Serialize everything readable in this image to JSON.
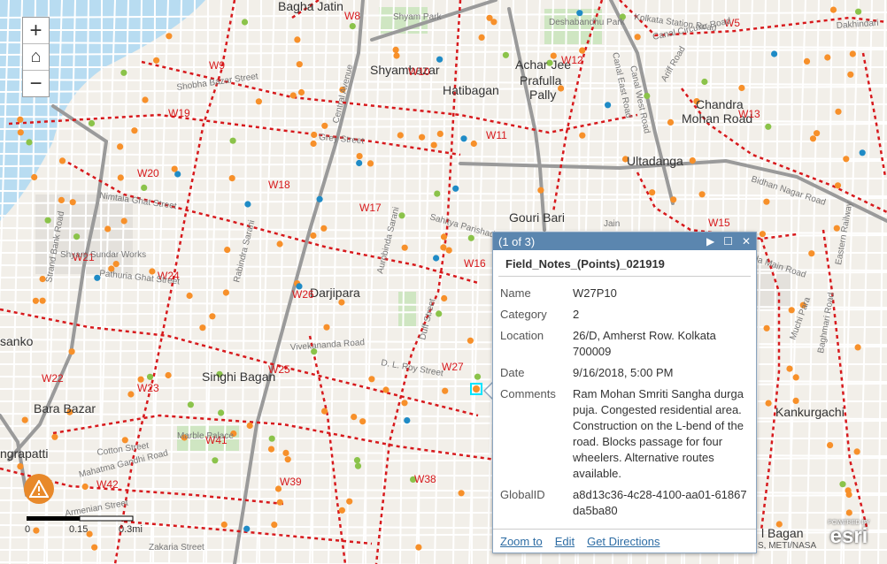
{
  "map": {
    "places": [
      {
        "name": "Bagha Jatin"
      },
      {
        "name": "Shyambazar"
      },
      {
        "name": "Achar Jee"
      },
      {
        "name": "Prafulla"
      },
      {
        "name": "Pally"
      },
      {
        "name": "Hatibagan"
      },
      {
        "name": "Chandra"
      },
      {
        "name": "Mohan Road"
      },
      {
        "name": "Ultadanga"
      },
      {
        "name": "Gouri Bari"
      },
      {
        "name": "Darjipara"
      },
      {
        "name": "Singhi Bagan"
      },
      {
        "name": "Bara Bazar"
      },
      {
        "name": "Kankurgachi"
      },
      {
        "name": "sanko"
      },
      {
        "name": "ngrapatti"
      },
      {
        "name": "l Bagan"
      }
    ],
    "wards": [
      "W8",
      "W5",
      "W9",
      "W10",
      "W12",
      "W19",
      "W13",
      "W11",
      "W20",
      "W18",
      "W17",
      "W16",
      "W21",
      "W24",
      "W26",
      "W22",
      "W25",
      "W27",
      "W23",
      "W41",
      "W42",
      "W39",
      "W38",
      "W15"
    ],
    "streets": [
      "Grey Street",
      "Nimtala Ghat Street",
      "Pathuria Ghat Street",
      "Strand Bank Road",
      "Canal East Road",
      "Canal West Road",
      "Canal Circular Road",
      "Ariff Road",
      "Bidhan Nagar Road",
      "Mahatma Gandhi Road",
      "Armenian Street",
      "Cotton Street",
      "Vivekananda Road",
      "D. L. Roy Street",
      "Sahitya Parishad Street",
      "Shobha Bazar Street",
      "Shyam Sundar Works",
      "Marble Palace",
      "Kolkata Station Road",
      "Dakhindari",
      "Shyam Park",
      "Deshabandhu Park",
      "Jain",
      "Eastern Railway",
      "Central Avenue",
      "Rabindra Sarani",
      "Aurobinda Sarani",
      "Duff Street",
      "Zakaria Street",
      "Muchi Para",
      "Baghmari Road",
      "Maniktala Main Road"
    ]
  },
  "popup": {
    "counter": "(1 of 3)",
    "title": "Field_Notes_(Points)_021919",
    "attributes": [
      {
        "key": "Name",
        "value": "W27P10"
      },
      {
        "key": "Category",
        "value": "2"
      },
      {
        "key": "Location",
        "value": "26/D, Amherst Row. Kolkata 700009"
      },
      {
        "key": "Date",
        "value": "9/16/2018, 5:00 PM"
      },
      {
        "key": "Comments",
        "value": "Ram Mohan Smriti Sangha durga puja. Congested residential area. Construction on the L-bend of the road. Blocks passage for four wheelers. Alternative routes available."
      },
      {
        "key": "GlobalID",
        "value": "a8d13c36-4c28-4100-aa01-61867da5ba80"
      }
    ],
    "actions": {
      "zoom": "Zoom to",
      "edit": "Edit",
      "directions": "Get Directions"
    }
  },
  "controls": {
    "zoom_in": "+",
    "home": "⌂",
    "zoom_out": "−"
  },
  "scale": {
    "labels": [
      "0",
      "0.15",
      "0.3mi"
    ]
  },
  "attribution": "S, METI/NASA",
  "esri": {
    "powered": "POWERED BY",
    "brand": "esri"
  },
  "colors": {
    "ward_boundary": "#d7191c",
    "point_orange": "#f7902a",
    "point_blue": "#1f8bc6",
    "point_green": "#8bc34a",
    "river": "#b8dcf1",
    "popup_header": "#5b86af"
  }
}
